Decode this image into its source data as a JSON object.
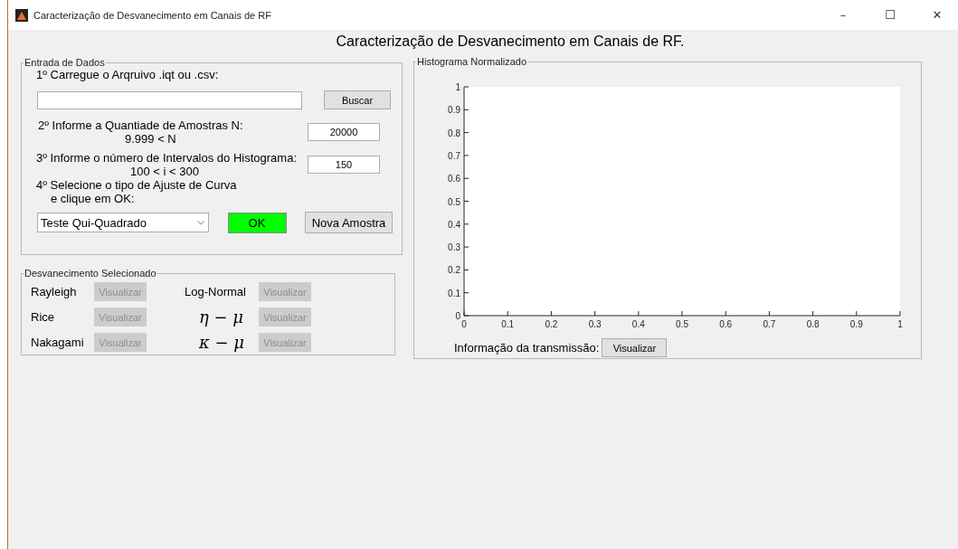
{
  "window": {
    "title": "Caracterização de Desvanecimento em Canais de RF",
    "controls": [
      "–",
      "☐",
      "✕"
    ]
  },
  "heading": "Caracterização de Desvanecimento em  Canais de RF.",
  "input_panel": {
    "title": "Entrada de Dados",
    "step1": {
      "label": "1º Carregue o Arqruivo .iqt ou .csv:",
      "browse_button": "Buscar"
    },
    "step2": {
      "label": "2º Informe a Quantiade de Amostras N:",
      "hint": "9.999 < N",
      "value": "20000"
    },
    "step3": {
      "label": "3º Informe o número de Intervalos do Histograma:",
      "hint": "100 < i < 300",
      "value": "150"
    },
    "step4": {
      "label": "4º Selecione o tipo de Ajuste de Curva",
      "label_line2": "e clique em OK:"
    },
    "fit_select": {
      "value": "Teste Qui-Quadrado"
    },
    "ok_button": "OK",
    "new_sample_button": "Nova Amostra"
  },
  "fading_panel": {
    "title": "Desvanecimento Selecionado",
    "items": [
      {
        "name": "Rayleigh",
        "kind": "text",
        "button": "Visualizar",
        "disabled": true
      },
      {
        "name": "Log-Normal",
        "kind": "text",
        "button": "Visualizar",
        "disabled": true
      },
      {
        "name": "Rice",
        "kind": "text",
        "button": "Visualizar",
        "disabled": true
      },
      {
        "name": "η − μ",
        "kind": "math",
        "button": "Visualizar",
        "disabled": true
      },
      {
        "name": "Nakagami",
        "kind": "text",
        "button": "Visualizar",
        "disabled": true
      },
      {
        "name": "κ − μ",
        "kind": "math",
        "button": "Visualizar",
        "disabled": true
      }
    ]
  },
  "histogram_panel": {
    "title": "Histograma Normalizado",
    "chart_data": {
      "type": "bar",
      "xlim": [
        0,
        1
      ],
      "ylim": [
        0,
        1
      ],
      "xticks": [
        {
          "value": 0,
          "label": "0"
        },
        {
          "value": 0.1,
          "label": "0.1"
        },
        {
          "value": 0.2,
          "label": "0.2"
        },
        {
          "value": 0.3,
          "label": "0.3"
        },
        {
          "value": 0.4,
          "label": "0.4"
        },
        {
          "value": 0.5,
          "label": "0.5"
        },
        {
          "value": 0.6,
          "label": "0.6"
        },
        {
          "value": 0.7,
          "label": "0.7"
        },
        {
          "value": 0.8,
          "label": "0.8"
        },
        {
          "value": 0.9,
          "label": "0.9"
        },
        {
          "value": 1,
          "label": "1"
        }
      ],
      "yticks": [
        {
          "value": 0,
          "label": "0"
        },
        {
          "value": 0.1,
          "label": "0.1"
        },
        {
          "value": 0.2,
          "label": "0.2"
        },
        {
          "value": 0.3,
          "label": "0.3"
        },
        {
          "value": 0.4,
          "label": "0.4"
        },
        {
          "value": 0.5,
          "label": "0.5"
        },
        {
          "value": 0.6,
          "label": "0.6"
        },
        {
          "value": 0.7,
          "label": "0.7"
        },
        {
          "value": 0.8,
          "label": "0.8"
        },
        {
          "value": 0.9,
          "label": "0.9"
        },
        {
          "value": 1,
          "label": "1"
        }
      ]
    },
    "transmission_label": "Informação da transmissão:",
    "transmission_button": "Visualizar"
  }
}
